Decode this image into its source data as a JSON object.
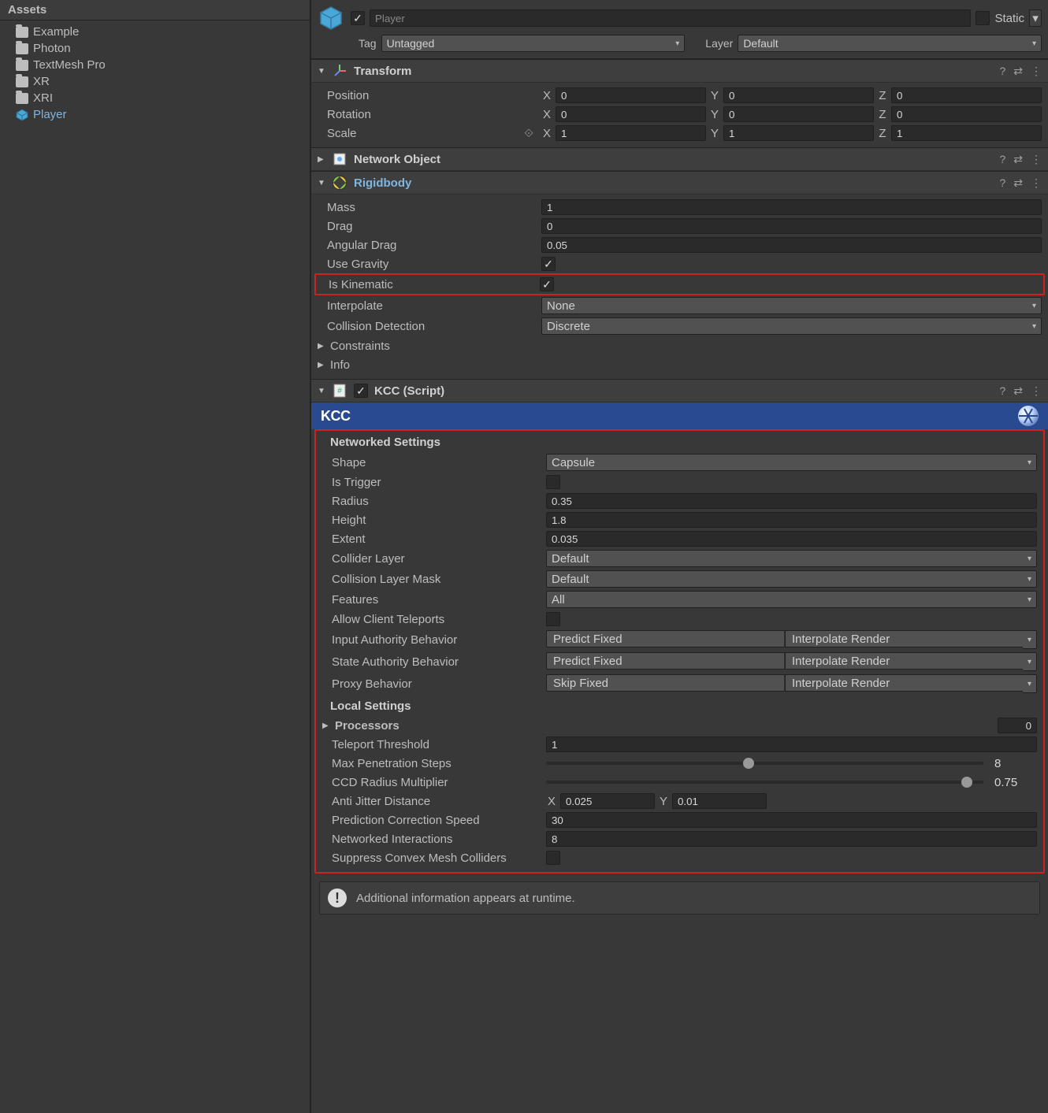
{
  "assets": {
    "header": "Assets",
    "items": [
      {
        "type": "folder",
        "label": "Example"
      },
      {
        "type": "folder",
        "label": "Photon"
      },
      {
        "type": "folder",
        "label": "TextMesh Pro"
      },
      {
        "type": "folder",
        "label": "XR"
      },
      {
        "type": "folder",
        "label": "XRI"
      },
      {
        "type": "prefab",
        "label": "Player",
        "selected": true
      }
    ]
  },
  "header": {
    "name": "Player",
    "enabled": true,
    "static_label": "Static",
    "tag_label": "Tag",
    "tag_value": "Untagged",
    "layer_label": "Layer",
    "layer_value": "Default"
  },
  "transform": {
    "title": "Transform",
    "position_label": "Position",
    "px": "0",
    "py": "0",
    "pz": "0",
    "rotation_label": "Rotation",
    "rx": "0",
    "ry": "0",
    "rz": "0",
    "scale_label": "Scale",
    "sx": "1",
    "sy": "1",
    "sz": "1"
  },
  "networkObject": {
    "title": "Network Object"
  },
  "rigidbody": {
    "title": "Rigidbody",
    "mass_label": "Mass",
    "mass": "1",
    "drag_label": "Drag",
    "drag": "0",
    "angdrag_label": "Angular Drag",
    "angdrag": "0.05",
    "usegrav_label": "Use Gravity",
    "usegrav": true,
    "iskin_label": "Is Kinematic",
    "iskin": true,
    "interp_label": "Interpolate",
    "interp": "None",
    "coldet_label": "Collision Detection",
    "coldet": "Discrete",
    "constraints_label": "Constraints",
    "info_label": "Info"
  },
  "kcc": {
    "title": "KCC (Script)",
    "banner": "KCC",
    "net_section": "Networked Settings",
    "shape_label": "Shape",
    "shape": "Capsule",
    "istrig_label": "Is Trigger",
    "istrig": false,
    "radius_label": "Radius",
    "radius": "0.35",
    "height_label": "Height",
    "height": "1.8",
    "extent_label": "Extent",
    "extent": "0.035",
    "collayer_label": "Collider Layer",
    "collayer": "Default",
    "colmask_label": "Collision Layer Mask",
    "colmask": "Default",
    "features_label": "Features",
    "features": "All",
    "allowtp_label": "Allow Client Teleports",
    "allowtp": false,
    "inputauth_label": "Input Authority Behavior",
    "inputauth1": "Predict Fixed",
    "inputauth2": "Interpolate Render",
    "stateauth_label": "State Authority Behavior",
    "stateauth1": "Predict Fixed",
    "stateauth2": "Interpolate Render",
    "proxy_label": "Proxy Behavior",
    "proxy1": "Skip Fixed",
    "proxy2": "Interpolate Render",
    "local_section": "Local Settings",
    "processors_label": "Processors",
    "processors": "0",
    "tpthresh_label": "Teleport Threshold",
    "tpthresh": "1",
    "maxpen_label": "Max Penetration Steps",
    "maxpen": "8",
    "maxpen_pct": 45,
    "ccdmul_label": "CCD Radius Multiplier",
    "ccdmul": "0.75",
    "ccdmul_pct": 95,
    "antijit_label": "Anti Jitter Distance",
    "antijit_x": "0.025",
    "antijit_y": "0.01",
    "predcorr_label": "Prediction Correction Speed",
    "predcorr": "30",
    "netint_label": "Networked Interactions",
    "netint": "8",
    "suppressconv_label": "Suppress Convex Mesh Colliders",
    "suppressconv": false,
    "runtime_info": "Additional information appears at runtime."
  }
}
